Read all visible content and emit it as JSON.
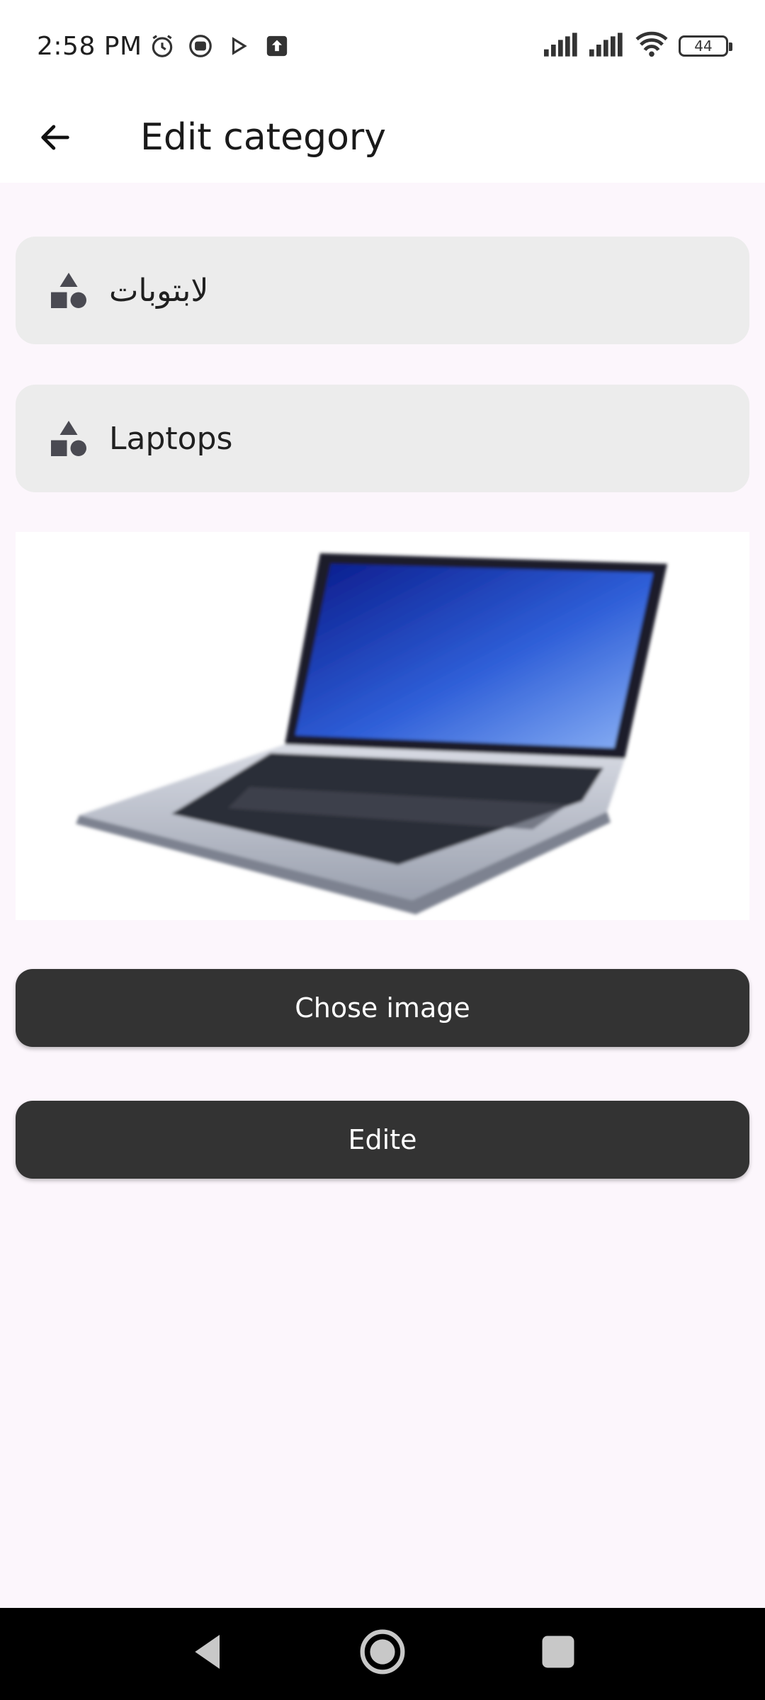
{
  "status_bar": {
    "time": "2:58 PM",
    "battery_level": "44",
    "icons": [
      "alarm-icon",
      "media-icon",
      "play-store-icon",
      "upload-icon",
      "signal-icon",
      "signal-icon",
      "wifi-icon",
      "battery-icon"
    ]
  },
  "app_bar": {
    "title": "Edit category",
    "back_icon": "arrow-left-icon"
  },
  "form": {
    "name_ar": {
      "value": "لابتوبات",
      "icon": "category-shapes-icon"
    },
    "name_en": {
      "value": "Laptops",
      "icon": "category-shapes-icon"
    },
    "image": {
      "subject": "laptop"
    }
  },
  "buttons": {
    "choose_image": "Chose image",
    "edit": "Edite"
  },
  "nav_bar": {
    "icons": [
      "back-triangle-icon",
      "home-circle-icon",
      "recents-square-icon"
    ]
  },
  "colors": {
    "background": "#fcf6fc",
    "field_bg": "#ececec",
    "button_bg": "#333333",
    "button_text": "#ffffff"
  }
}
